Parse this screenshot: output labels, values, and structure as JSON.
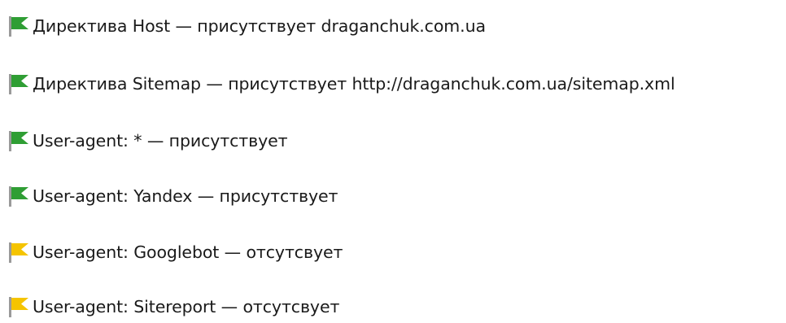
{
  "checks": [
    {
      "status": "ok",
      "text": "Директива Host — присутствует draganchuk.com.ua"
    },
    {
      "status": "ok",
      "text": "Директива Sitemap — присутствует http://draganchuk.com.ua/sitemap.xml"
    },
    {
      "status": "ok",
      "text": "User-agent: * — присутствует"
    },
    {
      "status": "ok",
      "text": "User-agent: Yandex — присутствует"
    },
    {
      "status": "warning",
      "text": "User-agent: Googlebot — отсутсвует"
    },
    {
      "status": "warning",
      "text": "User-agent: Sitereport — отсутсвует"
    }
  ],
  "icons": {
    "ok": {
      "name": "green-flag-icon",
      "color": "#2f9e34"
    },
    "warning": {
      "name": "yellow-flag-icon",
      "color": "#f5c400"
    }
  },
  "pole_color": "#9a9a9a"
}
